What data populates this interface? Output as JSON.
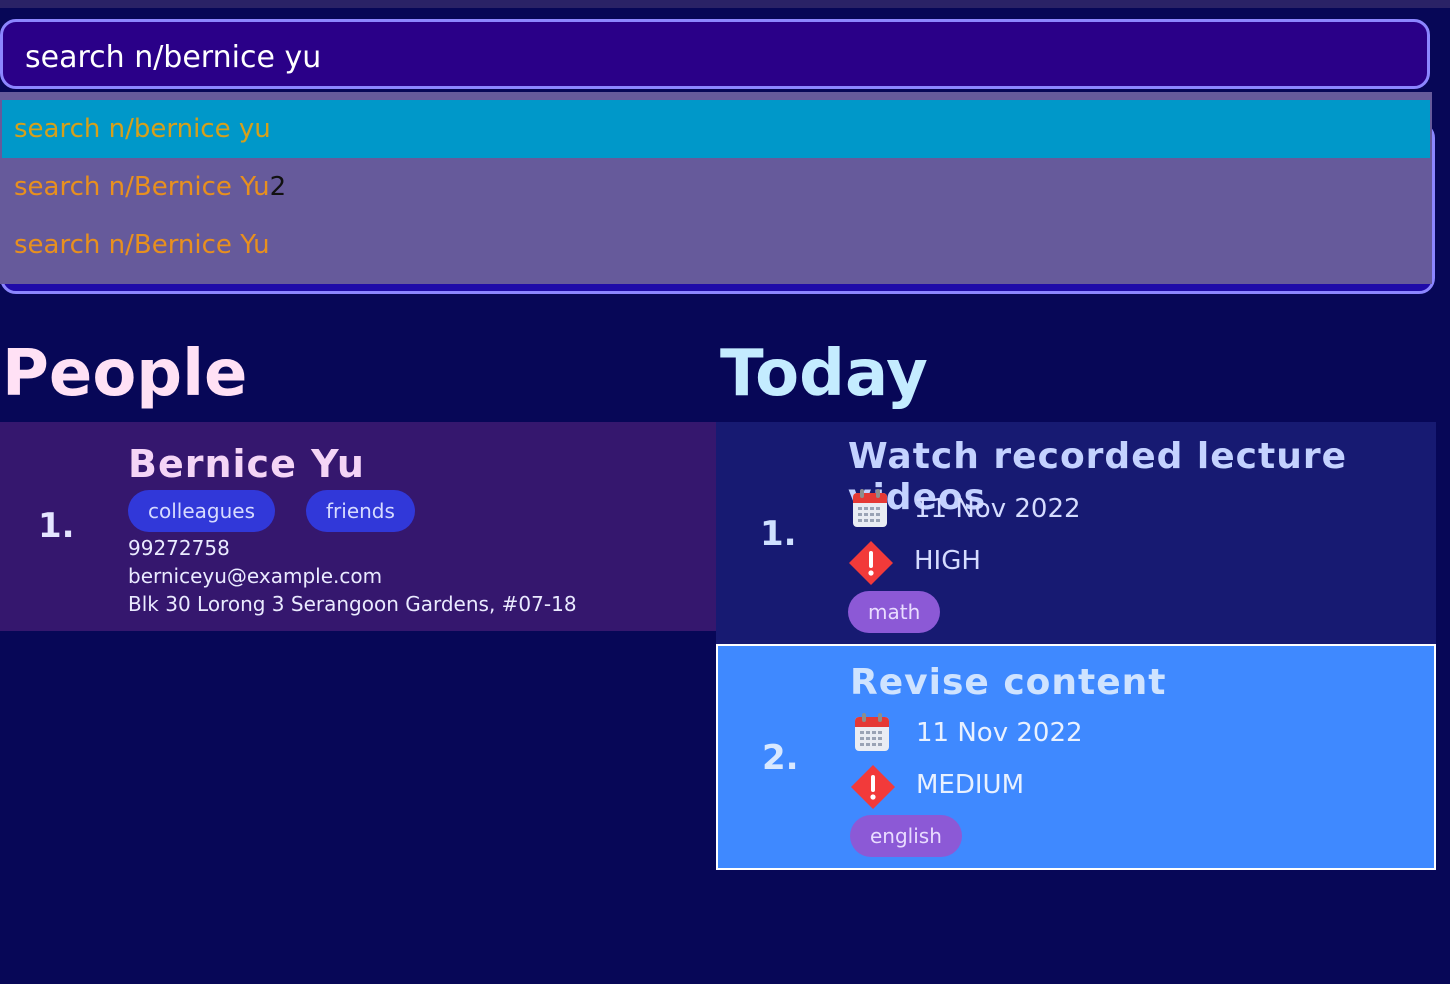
{
  "command": {
    "value": "search n/bernice yu"
  },
  "suggestions": [
    {
      "text": "search n/bernice yu",
      "extra": "",
      "selected": true
    },
    {
      "text": "search n/Bernice Yu",
      "extra": "2",
      "selected": false
    },
    {
      "text": "search n/Bernice Yu",
      "extra": "",
      "selected": false
    }
  ],
  "people_section": {
    "title": "People",
    "persons": [
      {
        "index": "1.",
        "name": "Bernice Yu",
        "tags": [
          "colleagues",
          "friends"
        ],
        "phone": "99272758",
        "email": "berniceyu@example.com",
        "address": "Blk 30 Lorong 3 Serangoon Gardens, #07-18"
      }
    ]
  },
  "today_section": {
    "title": "Today",
    "tasks": [
      {
        "index": "1.",
        "title": "Watch recorded lecture videos",
        "date": "11 Nov 2022",
        "priority": "HIGH",
        "tag": "math",
        "date_icon": "calendar-icon",
        "priority_icon": "priority-warning-icon"
      },
      {
        "index": "2.",
        "title": "Revise content",
        "date": "11 Nov 2022",
        "priority": "MEDIUM",
        "tag": "english",
        "date_icon": "calendar-icon",
        "priority_icon": "priority-warning-icon"
      }
    ]
  },
  "colors": {
    "background": "#070757",
    "selected_suggestion": "#0098c9",
    "selected_task": "#3f89ff",
    "person_tag": "#3138d9",
    "task_tag": "#8c59d6"
  }
}
